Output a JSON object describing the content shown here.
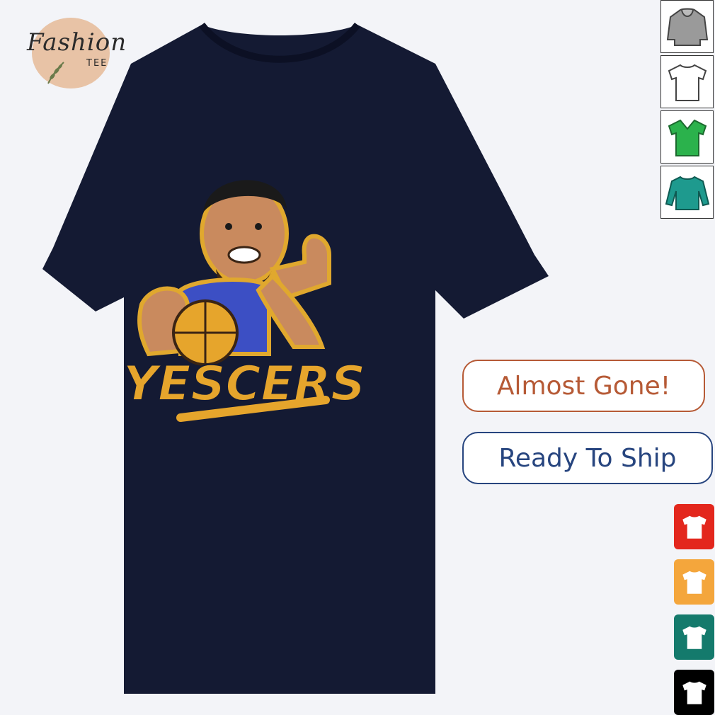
{
  "brand": {
    "name": "Fashion",
    "sub": "TEE"
  },
  "product": {
    "graphic_text": "YESCERS",
    "shirt_color": "#141a33"
  },
  "badges": {
    "almost_gone": "Almost Gone!",
    "ready_to_ship": "Ready To Ship"
  },
  "product_type_thumbnails": [
    {
      "icon": "hoodie-icon",
      "color": "#9a9a9a"
    },
    {
      "icon": "tshirt-icon",
      "color": "#ffffff"
    },
    {
      "icon": "vneck-icon",
      "color": "#2bb24c"
    },
    {
      "icon": "sweatshirt-icon",
      "color": "#1e9a8e"
    }
  ],
  "color_swatches": [
    {
      "icon": "tshirt-icon",
      "color": "#e3271d"
    },
    {
      "icon": "tshirt-icon",
      "color": "#f4a63c"
    },
    {
      "icon": "tshirt-icon",
      "color": "#147a6c"
    },
    {
      "icon": "tshirt-icon",
      "color": "#000000"
    }
  ]
}
